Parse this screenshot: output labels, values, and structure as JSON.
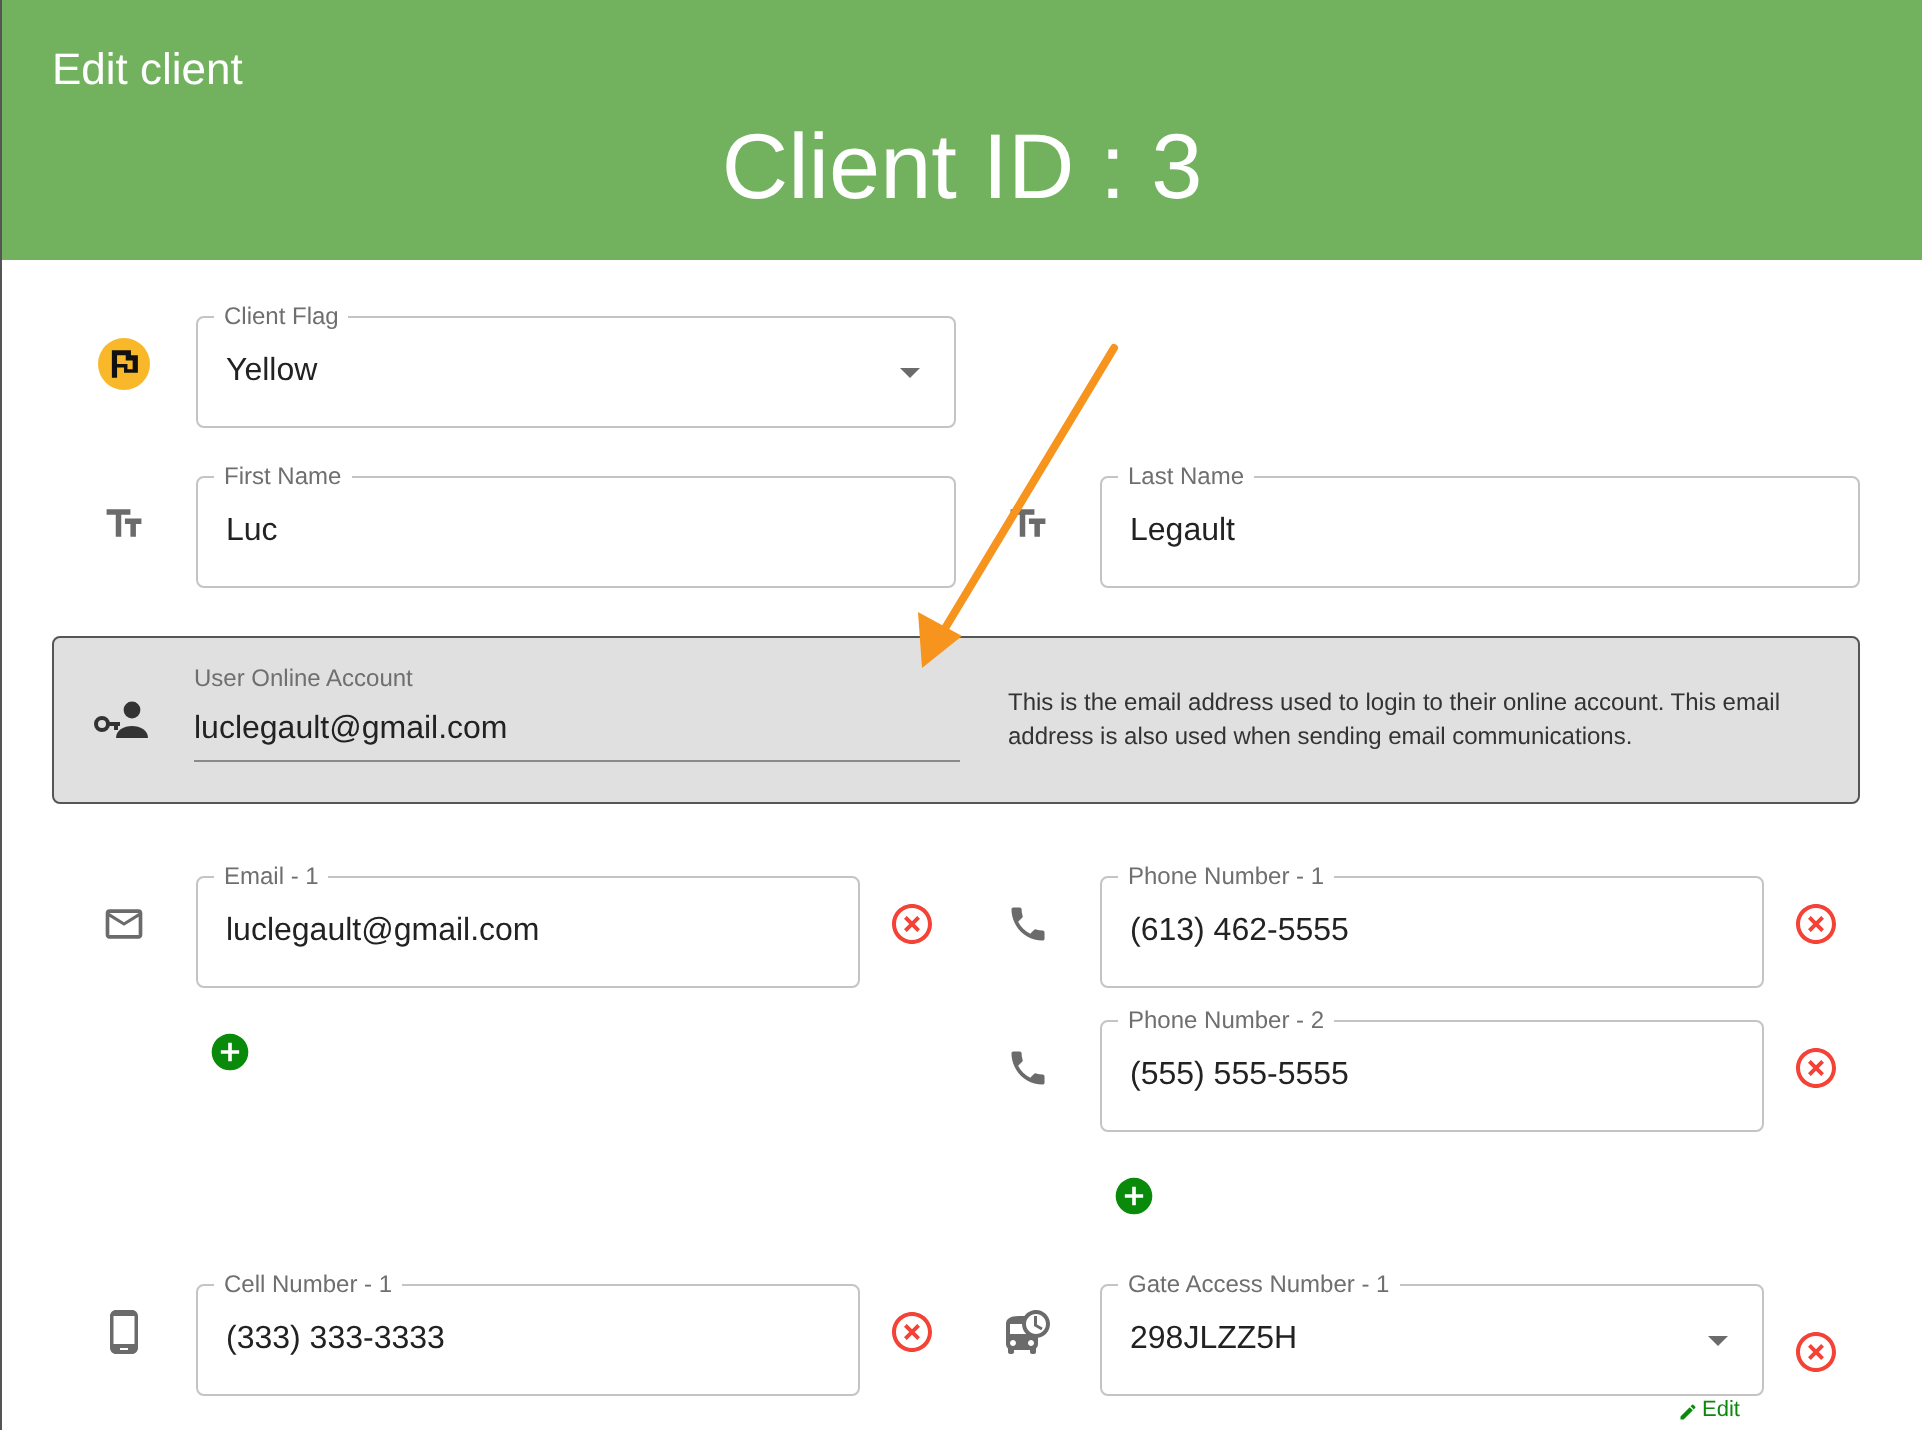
{
  "header": {
    "title": "Edit client",
    "client_id": "Client ID : 3"
  },
  "client_flag": {
    "label": "Client Flag",
    "value": "Yellow"
  },
  "first_name": {
    "label": "First Name",
    "value": "Luc"
  },
  "last_name": {
    "label": "Last Name",
    "value": "Legault"
  },
  "online_account": {
    "label": "User Online Account",
    "value": "luclegault@gmail.com",
    "note": "This is the email address used to login to their online account. This email address is also used when sending email communications."
  },
  "emails": [
    {
      "label": "Email - 1",
      "value": "luclegault@gmail.com"
    }
  ],
  "phones": [
    {
      "label": "Phone Number - 1",
      "value": "(613) 462-5555"
    },
    {
      "label": "Phone Number - 2",
      "value": "(555) 555-5555"
    }
  ],
  "cell_numbers": [
    {
      "label": "Cell Number - 1",
      "value": "(333) 333-3333"
    }
  ],
  "gate_access_numbers": [
    {
      "label": "Gate Access Number - 1",
      "value": "298JLZZ5H",
      "edit_label": "Edit"
    }
  ]
}
